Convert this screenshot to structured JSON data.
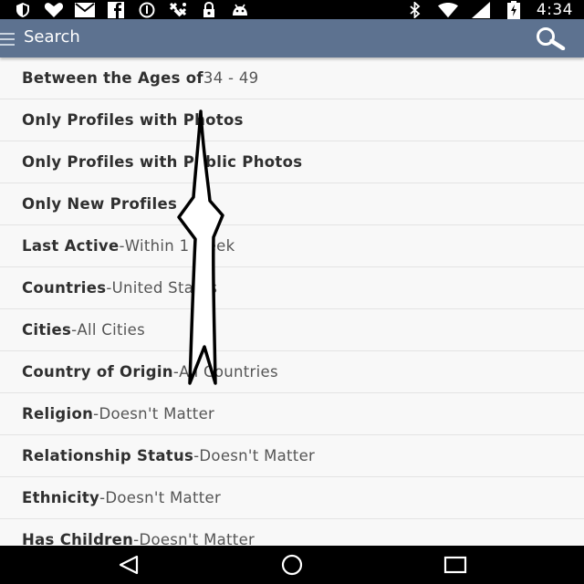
{
  "status_bar": {
    "time": "4:34",
    "left_icons": [
      "shield-icon",
      "heart-icon",
      "mail-icon",
      "facebook-icon",
      "info-icon",
      "satellite-icon",
      "lock-icon",
      "android-icon"
    ],
    "right_icons": [
      "bluetooth-icon",
      "wifi-icon",
      "signal-icon",
      "battery-charging-icon"
    ]
  },
  "app_bar": {
    "title": "Search",
    "color": "#5d7290"
  },
  "filters": [
    {
      "label": "Between the Ages of",
      "sep": " ",
      "value": "34 - 49"
    },
    {
      "label": "Only Profiles with Photos",
      "sep": "",
      "value": ""
    },
    {
      "label": "Only Profiles with Public Photos",
      "sep": "",
      "value": ""
    },
    {
      "label": "Only New Profiles",
      "sep": "",
      "value": ""
    },
    {
      "label": "Last Active",
      "sep": " - ",
      "value": "Within 1 week"
    },
    {
      "label": "Countries",
      "sep": " - ",
      "value": "United States"
    },
    {
      "label": "Cities",
      "sep": " - ",
      "value": "All Cities"
    },
    {
      "label": "Country of Origin",
      "sep": " - ",
      "value": "All Countries"
    },
    {
      "label": "Religion",
      "sep": " - ",
      "value": "Doesn't Matter"
    },
    {
      "label": "Relationship Status",
      "sep": " - ",
      "value": "Doesn't Matter"
    },
    {
      "label": "Ethnicity",
      "sep": " - ",
      "value": "Doesn't Matter"
    },
    {
      "label": "Has Children",
      "sep": " - ",
      "value": "Doesn't Matter"
    }
  ],
  "nav_bar": {
    "buttons": [
      "back-icon",
      "home-icon",
      "recents-icon"
    ]
  }
}
